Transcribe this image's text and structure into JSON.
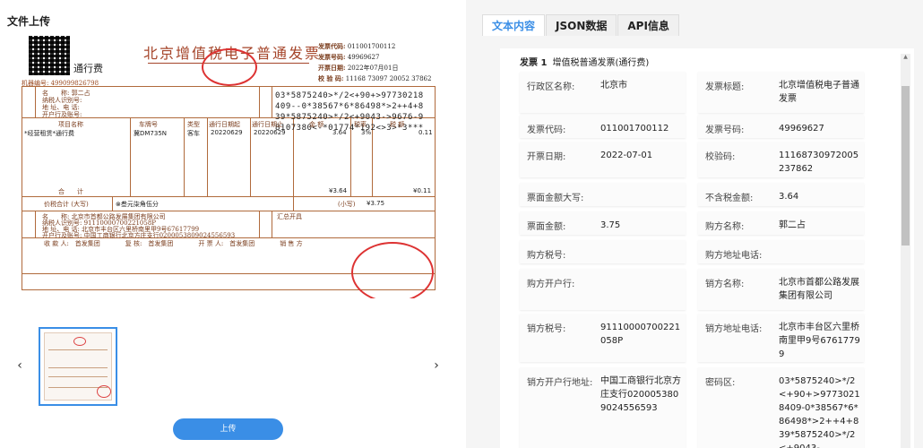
{
  "left": {
    "title": "文件上传",
    "upload_button": "上传",
    "prev_arrow": "‹",
    "next_arrow": "›",
    "invoice": {
      "title": "北京增值税电子普通发票",
      "type_label": "通行费",
      "machine_code": "机器编号: 499099826798",
      "meta": [
        {
          "label": "发票代码:",
          "value": "011001700112"
        },
        {
          "label": "发票号码:",
          "value": "49969627"
        },
        {
          "label": "开票日期:",
          "value": "2022年07月01日"
        },
        {
          "label": "校 验 码:",
          "value": "11168 73097 20052 37862"
        }
      ],
      "buyer_labels": [
        "名　　称: 郭二占",
        "纳税人识别号:",
        "地 址、电 话:",
        "开户行及账号:"
      ],
      "cipher": [
        "03*5875240>*/2<+90+>97730218",
        "409--0*38567*6*86498*>2++4+8",
        "39*5875240>*/2<+9043->9676-9",
        "8107380<-*01774*192<>3>*3***"
      ],
      "items_header": [
        "项目名称",
        "车牌号",
        "类型",
        "通行日期起",
        "通行日期止",
        "金 额",
        "税率",
        "税 额"
      ],
      "item_row": [
        "*经营租赁*通行费",
        "冀DM735N",
        "客车",
        "20220629",
        "20220629",
        "3.64",
        "3%",
        "0.11"
      ],
      "total_label": "合　　计",
      "total_amount": "¥3.64",
      "total_tax": "¥0.11",
      "sum_label": "价税合计 (大写)",
      "sum_words": "⊗叁元柒角伍分",
      "sum_small_label": "(小写)",
      "sum_small": "¥3.75",
      "seller_lines": [
        "名　　称: 北京市首都公路发展集团有限公司",
        "纳税人识别号: 91110000700221058P",
        "地 址、电 话: 北京市丰台区六里桥南里甲9号67617799",
        "开户行及账号: 中国工商银行北京方庄支行0200053809024556593"
      ],
      "remark_label": "汇总开具",
      "footer": "收 款 人:　首发集团　　　　复 核:　首发集团　　　　开 票 人:　首发集团　　　　销 售 方"
    }
  },
  "right": {
    "tabs": [
      "文本内容",
      "JSON数据",
      "API信息"
    ],
    "active_tab": "文本内容",
    "section_index": "发票 1",
    "section_title": "增值税普通发票(通行费)",
    "rows": [
      [
        {
          "k": "行政区名称:",
          "v": "北京市"
        },
        {
          "k": "发票标题:",
          "v": "北京增值税电子普通发票"
        }
      ],
      [
        {
          "k": "发票代码:",
          "v": "011001700112"
        },
        {
          "k": "发票号码:",
          "v": "49969627"
        }
      ],
      [
        {
          "k": "开票日期:",
          "v": "2022-07-01"
        },
        {
          "k": "校验码:",
          "v": "11168730972005237862"
        }
      ],
      [
        {
          "k": "票面金额大写:",
          "v": ""
        },
        {
          "k": "不含税金额:",
          "v": "3.64"
        }
      ],
      [
        {
          "k": "票面金额:",
          "v": "3.75"
        },
        {
          "k": "购方名称:",
          "v": "郭二占"
        }
      ],
      [
        {
          "k": "购方税号:",
          "v": ""
        },
        {
          "k": "购方地址电话:",
          "v": ""
        }
      ],
      [
        {
          "k": "购方开户行:",
          "v": ""
        },
        {
          "k": "销方名称:",
          "v": "北京市首都公路发展集团有限公司"
        }
      ],
      [
        {
          "k": "销方税号:",
          "v": "91110000700221058P"
        },
        {
          "k": "销方地址电话:",
          "v": "北京市丰台区六里桥南里甲9号67617799"
        }
      ],
      [
        {
          "k": "销方开户行地址:",
          "v": "中国工商银行北京方庄支行0200053809024556593"
        },
        {
          "k": "密码区:",
          "v": "03*5875240>*/2<+90+>97730218409-0*38567*6*86498*>2++4+839*5875240>*/2<+9043-"
        }
      ]
    ]
  }
}
